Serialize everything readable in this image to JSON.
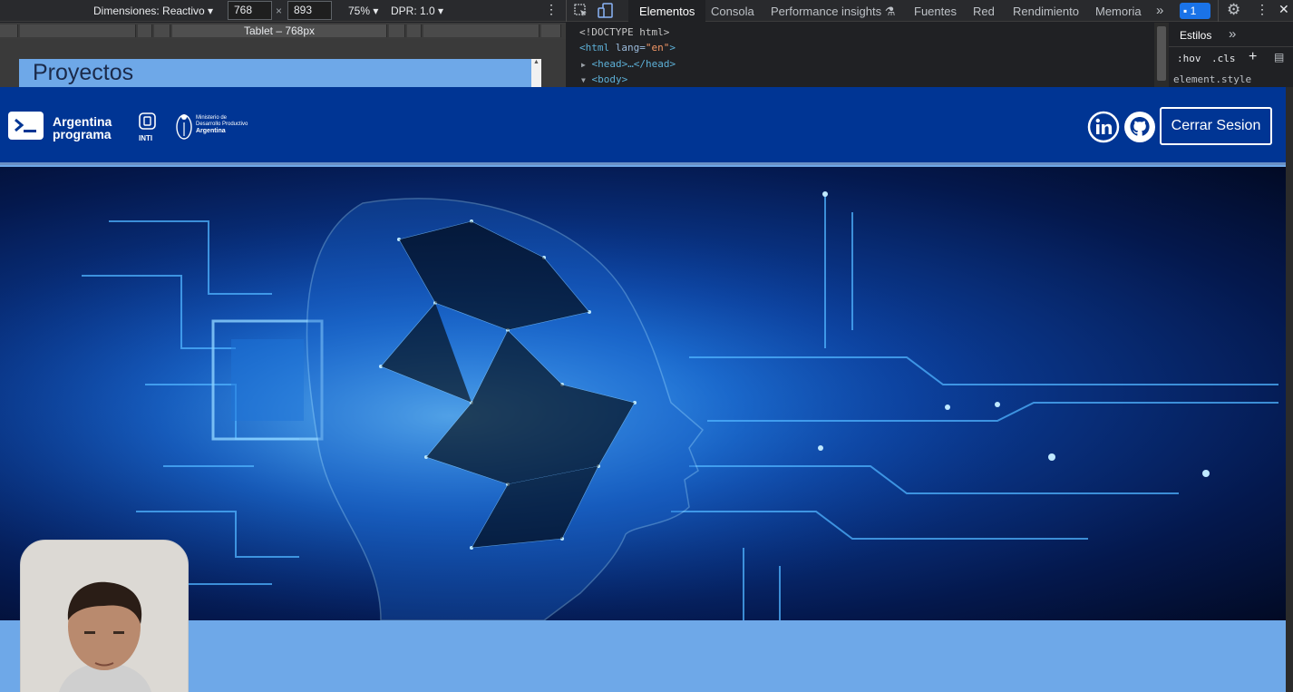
{
  "devtools": {
    "dimensions_label": "Dimensiones: Reactivo",
    "width": "768",
    "times": "×",
    "height": "893",
    "zoom": "75%",
    "dpr": "DPR: 1.0",
    "device_label": "Tablet – 768px",
    "tabs": [
      "Elementos",
      "Consola",
      "Performance insights",
      "Fuentes",
      "Red",
      "Rendimiento",
      "Memoria"
    ],
    "more_tabs": "»",
    "issues_count": "1",
    "code": {
      "line1": "<!DOCTYPE html>",
      "line2_open": "<html",
      "line2_attr": " lang=",
      "line2_val": "\"en\"",
      "line2_close": ">",
      "line3": "<head>…</head>",
      "line4": "<body>"
    },
    "styles_tab": "Estilos",
    "styles_more": "»",
    "hov": ":hov",
    "cls": ".cls",
    "plus": "+",
    "element_style": "element.style"
  },
  "page": {
    "section_title": "Proyectos",
    "brand_name_1": "Argentina",
    "brand_name_2": "programa",
    "inti_label": "INTI",
    "ministry_1": "Ministerio de",
    "ministry_2": "Desarrollo Productivo",
    "ministry_3": "Argentina",
    "logout_label": "Cerrar Sesion"
  },
  "colors": {
    "header_bg": "#003594",
    "page_bg": "#6ea8e8",
    "devtools_bg": "#202124"
  }
}
